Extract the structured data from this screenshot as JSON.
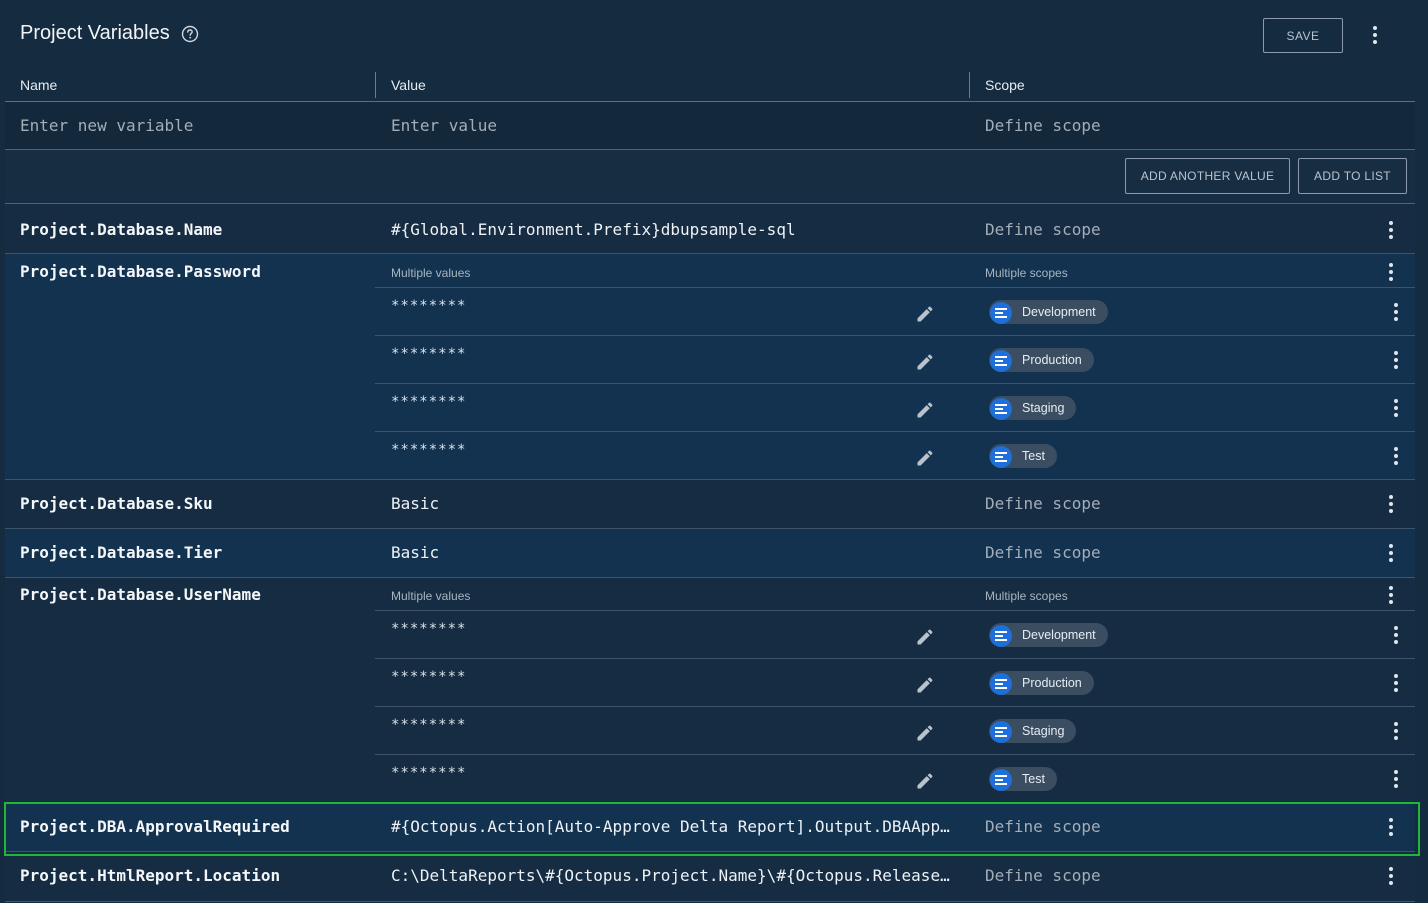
{
  "header": {
    "title": "Project Variables",
    "help_icon": "help-circle-icon",
    "save_label": "SAVE",
    "more_icon": "more-vert-icon"
  },
  "columns": {
    "name": "Name",
    "value": "Value",
    "scope": "Scope"
  },
  "new_variable": {
    "name_placeholder": "Enter new variable",
    "value_placeholder": "Enter value",
    "scope_placeholder": "Define scope"
  },
  "actions": {
    "add_another_value": "ADD ANOTHER VALUE",
    "add_to_list": "ADD TO LIST"
  },
  "labels": {
    "multiple_values": "Multiple values",
    "multiple_scopes": "Multiple scopes",
    "define_scope": "Define scope"
  },
  "variables": [
    {
      "name": "Project.Database.Name",
      "value": "#{Global.Environment.Prefix}dbupsample-sql",
      "scope": "Define scope"
    },
    {
      "name": "Project.Database.Password",
      "values": [
        {
          "value": "********",
          "scope": "Development"
        },
        {
          "value": "********",
          "scope": "Production"
        },
        {
          "value": "********",
          "scope": "Staging"
        },
        {
          "value": "********",
          "scope": "Test"
        }
      ]
    },
    {
      "name": "Project.Database.Sku",
      "value": "Basic",
      "scope": "Define scope"
    },
    {
      "name": "Project.Database.Tier",
      "value": "Basic",
      "scope": "Define scope"
    },
    {
      "name": "Project.Database.UserName",
      "values": [
        {
          "value": "********",
          "scope": "Development"
        },
        {
          "value": "********",
          "scope": "Production"
        },
        {
          "value": "********",
          "scope": "Staging"
        },
        {
          "value": "********",
          "scope": "Test"
        }
      ]
    },
    {
      "name": "Project.DBA.ApprovalRequired",
      "value": "#{Octopus.Action[Auto-Approve Delta Report].Output.DBAApp…",
      "scope": "Define scope"
    },
    {
      "name": "Project.HtmlReport.Location",
      "value": "C:\\DeltaReports\\#{Octopus.Project.Name}\\#{Octopus.Release…",
      "scope": "Define scope"
    }
  ],
  "colors": {
    "background": "#142b40",
    "highlight": "#1fb835",
    "chip": "#3b4e61",
    "chip_icon": "#1e6fd9"
  }
}
